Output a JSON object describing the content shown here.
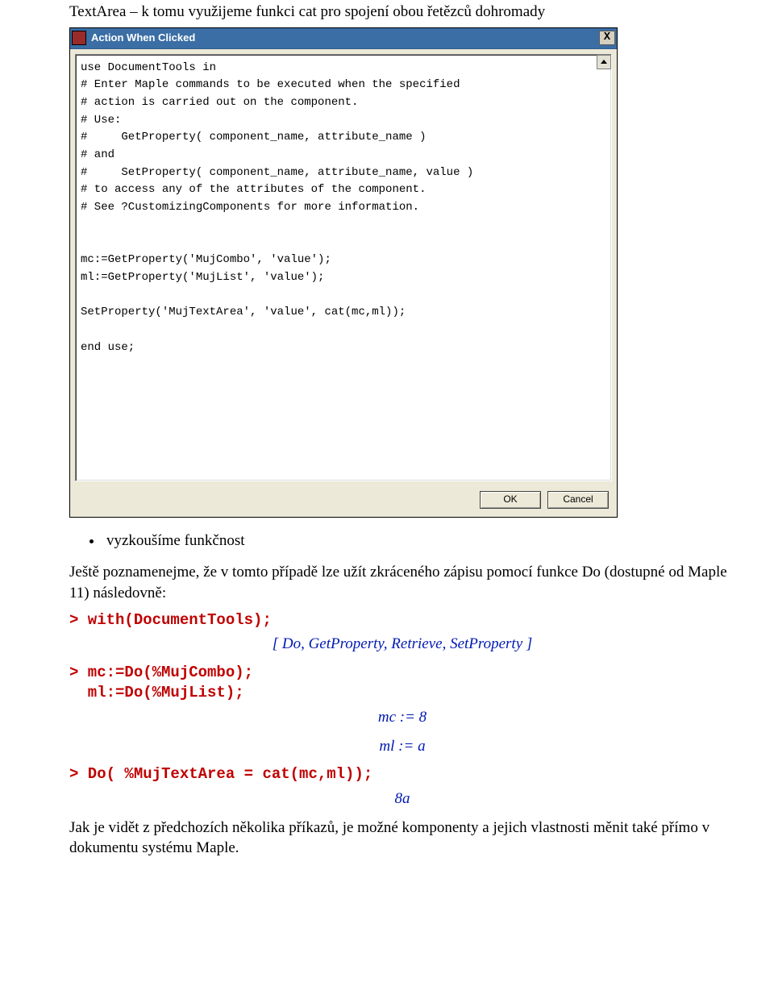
{
  "intro_top": "TextArea – k tomu využijeme funkci cat pro spojení obou řetězců dohromady",
  "dialog": {
    "title": "Action When Clicked",
    "code": "use DocumentTools in\n# Enter Maple commands to be executed when the specified\n# action is carried out on the component.\n# Use:\n#     GetProperty( component_name, attribute_name )\n# and\n#     SetProperty( component_name, attribute_name, value )\n# to access any of the attributes of the component.\n# See ?CustomizingComponents for more information.\n\n\nmc:=GetProperty('MujCombo', 'value');\nml:=GetProperty('MujList', 'value');\n\nSetProperty('MujTextArea', 'value', cat(mc,ml));\n\nend use;",
    "ok_label": "OK",
    "cancel_label": "Cancel"
  },
  "bullet1": "vyzkoušíme funkčnost",
  "para_mid": "Ještě poznamenejme, že v tomto případě lze užít zkráceného zápisu pomocí funkce Do (dostupné od Maple 11) následovně:",
  "in1": "> with(DocumentTools);",
  "out1": "[ Do, GetProperty, Retrieve, SetProperty ]",
  "in2": "> mc:=Do(%MujCombo);\n  ml:=Do(%MujList);",
  "out2a": "mc := 8",
  "out2b": "ml := a",
  "in3": "> Do( %MujTextArea = cat(mc,ml));",
  "out3": "8a",
  "para_end": "Jak je vidět z předchozích několika příkazů, je možné komponenty a jejich vlastnosti měnit také přímo v dokumentu systému Maple."
}
